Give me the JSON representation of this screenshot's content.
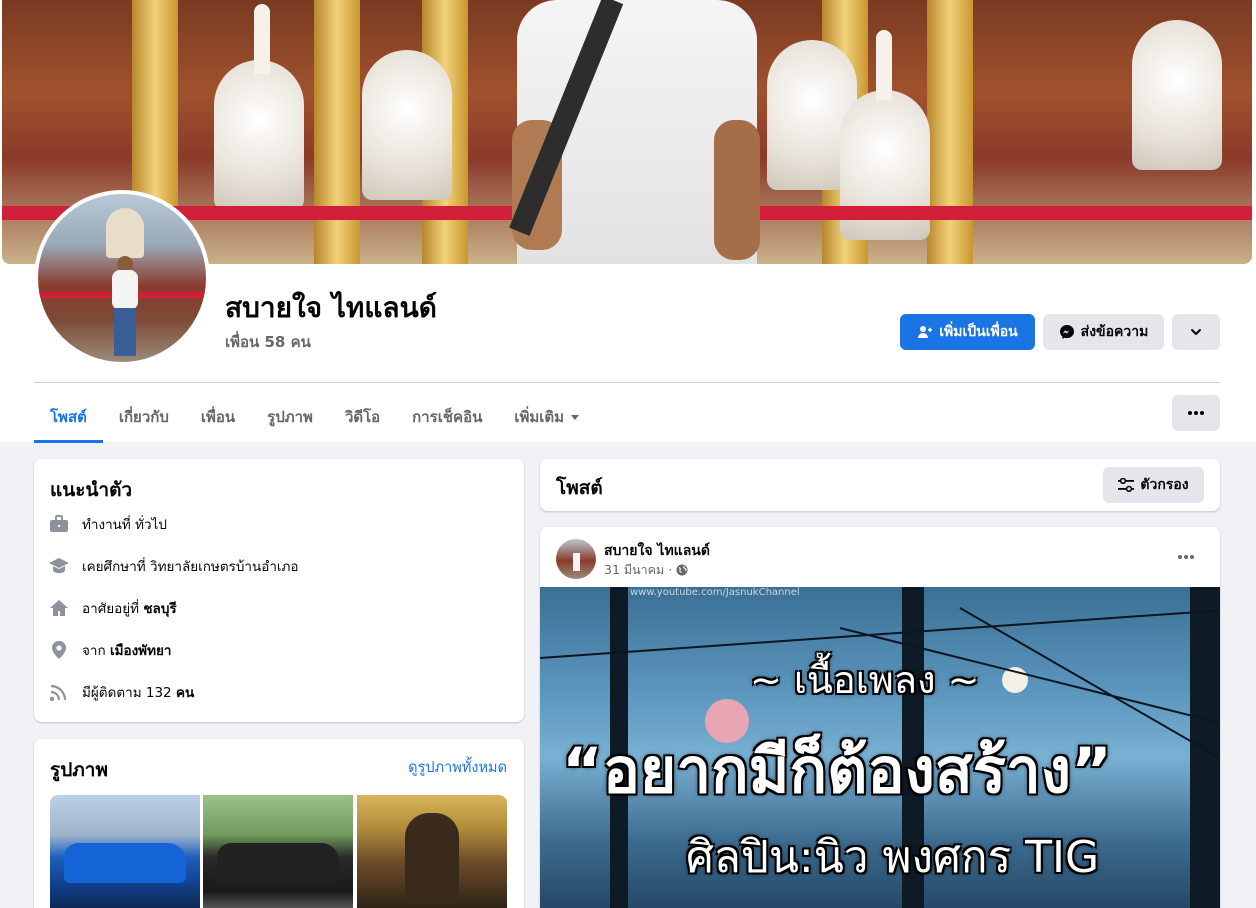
{
  "profile": {
    "name": "สบายใจ ไทแลนด์",
    "friends": "เพื่อน 58 คน",
    "add_friend_label": "เพิ่มเป็นเพื่อน",
    "message_label": "ส่งข้อความ"
  },
  "tabs": [
    {
      "label": "โพสต์"
    },
    {
      "label": "เกี่ยวกับ"
    },
    {
      "label": "เพื่อน"
    },
    {
      "label": "รูปภาพ"
    },
    {
      "label": "วิดีโอ"
    },
    {
      "label": "การเช็คอิน"
    },
    {
      "label": "เพิ่มเติม"
    }
  ],
  "intro": {
    "title": "แนะนำตัว",
    "work": {
      "prefix": "ทำงานที่",
      "value": "ทั่วไป"
    },
    "education": {
      "prefix": "เคยศึกษาที่",
      "value": "วิทยาลัยเกษตรบ้านอำเภอ"
    },
    "lives": {
      "prefix": "อาศัยอยู่ที่",
      "value": "ชลบุรี"
    },
    "from": {
      "prefix": "จาก",
      "value": "เมืองพัทยา"
    },
    "followers": {
      "prefix": "มีผู้ติดตาม 132",
      "value": "คน"
    }
  },
  "photos": {
    "title": "รูปภาพ",
    "see_all": "ดูรูปภาพทั้งหมด"
  },
  "posts_section": {
    "title": "โพสต์",
    "filter_label": "ตัวกรอง"
  },
  "post": {
    "author": "สบายใจ ไทแลนด์",
    "date": "31 มีนาคม ·",
    "image_text": {
      "line1": "~ เนื้อเพลง ~",
      "line2": "“อยากมีก็ต้องสร้าง”",
      "line3": "ศิลปิน:นิว พงศกร TIG",
      "watermark": "www.youtube.com/JasnukChannel"
    }
  },
  "colors": {
    "accent": "#1b74e4",
    "background": "#f0f2f5",
    "secondary_button": "#e4e6eb",
    "muted_text": "#65676b"
  },
  "icons": [
    "add-friend-icon",
    "messenger-icon",
    "chevron-down-icon",
    "more-dots-icon",
    "briefcase-icon",
    "graduation-cap-icon",
    "home-icon",
    "location-pin-icon",
    "followers-icon",
    "filter-icon",
    "globe-icon",
    "caret-down-icon"
  ]
}
